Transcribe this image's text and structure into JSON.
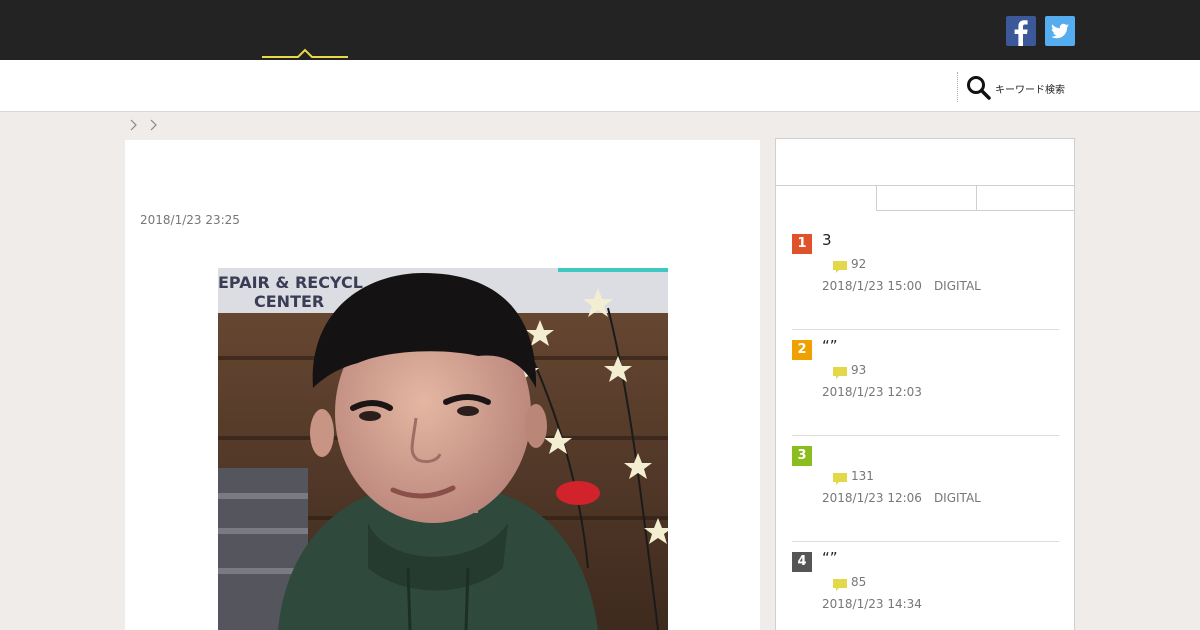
{
  "header": {
    "social": [
      {
        "name": "facebook",
        "icon": "facebook-icon",
        "color": "#3b5998"
      },
      {
        "name": "twitter",
        "icon": "twitter-icon",
        "color": "#55acee"
      }
    ],
    "accent_color": "#e8d84a"
  },
  "search": {
    "label": "キーワード検索",
    "icon": "search-icon"
  },
  "article": {
    "date": "2018/1/23 23:25",
    "photo": {
      "sign_text_line1": "EPAIR & RECYCL",
      "sign_text_line2": "CENTER"
    }
  },
  "ranking": {
    "items": [
      {
        "rank": "1",
        "title": "3",
        "comments": "92",
        "date": "2018/1/23 15:00",
        "category": "DIGITAL",
        "badge_color": "#e0522c"
      },
      {
        "rank": "2",
        "title": "“”",
        "comments": "93",
        "date": "2018/1/23 12:03",
        "category": "",
        "badge_color": "#f0a000"
      },
      {
        "rank": "3",
        "title": "",
        "comments": "131",
        "date": "2018/1/23 12:06",
        "category": "DIGITAL",
        "badge_color": "#8cbd1e"
      },
      {
        "rank": "4",
        "title": "“”",
        "comments": "85",
        "date": "2018/1/23 14:34",
        "category": "",
        "badge_color": "#555555"
      }
    ]
  }
}
